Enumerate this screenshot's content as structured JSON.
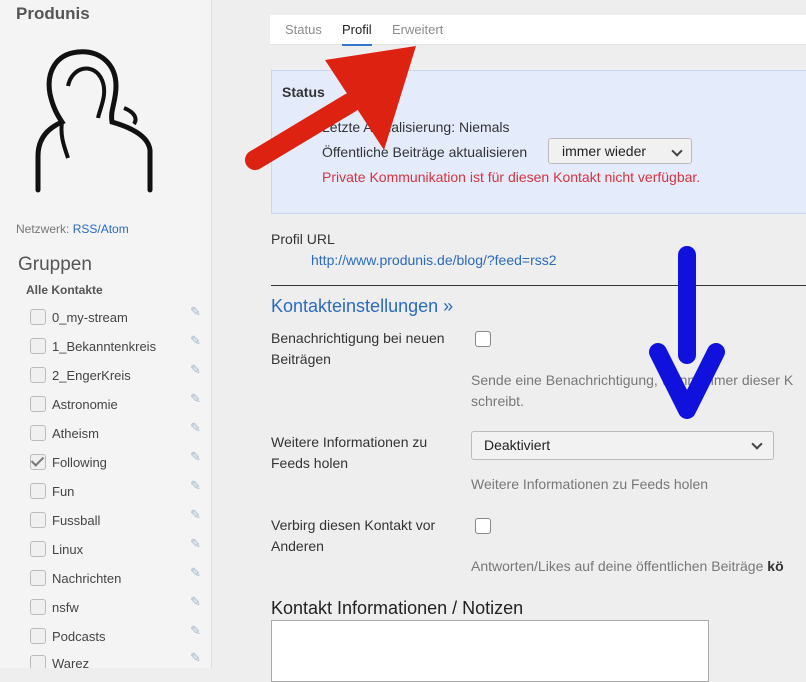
{
  "sidebar": {
    "contact_name": "Produnis",
    "network_label": "Netzwerk:",
    "network_value": "RSS/Atom",
    "groups_heading": "Gruppen",
    "all_contacts": "Alle Kontakte",
    "groups": [
      {
        "label": "0_my-stream",
        "checked": false
      },
      {
        "label": "1_Bekanntenkreis",
        "checked": false
      },
      {
        "label": "2_EngerKreis",
        "checked": false
      },
      {
        "label": "Astronomie",
        "checked": false
      },
      {
        "label": "Atheism",
        "checked": false
      },
      {
        "label": "Following",
        "checked": true
      },
      {
        "label": "Fun",
        "checked": false
      },
      {
        "label": "Fussball",
        "checked": false
      },
      {
        "label": "Linux",
        "checked": false
      },
      {
        "label": "Nachrichten",
        "checked": false
      },
      {
        "label": "nsfw",
        "checked": false
      },
      {
        "label": "Podcasts",
        "checked": false
      },
      {
        "label": "Warez",
        "checked": false
      }
    ]
  },
  "tabs": [
    {
      "label": "Status",
      "active": false
    },
    {
      "label": "Profil",
      "active": true
    },
    {
      "label": "Erweitert",
      "active": false
    }
  ],
  "status": {
    "title": "Status",
    "last_update": "Letzte Aktualisierung: Niemals",
    "public_posts_label": "Öffentliche Beiträge aktualisieren",
    "public_posts_value": "immer wieder",
    "private_note": "Private Kommunikation ist für diesen Kontakt nicht verfügbar."
  },
  "profile": {
    "url_label": "Profil URL",
    "url": "http://www.produnis.de/blog/?feed=rss2"
  },
  "settings": {
    "heading": "Kontakteinstellungen »",
    "notify_label": "Benachrichtigung bei neuen Beiträgen",
    "notify_help": "Sende eine Benachrichtigung, wann immer dieser K",
    "notify_help_2": "schreibt.",
    "feed_label": "Weitere Informationen zu Feeds holen",
    "feed_value": "Deaktiviert",
    "feed_help": "Weitere Informationen zu Feeds holen",
    "hide_label": "Verbirg diesen Kontakt vor Anderen",
    "hide_help": "Antworten/Likes auf deine öffentlichen Beiträge ",
    "hide_help_bold": "kö"
  },
  "notes": {
    "heading": "Kontakt Informationen / Notizen"
  },
  "colors": {
    "link": "#2a6bbf",
    "warning": "#d8323d",
    "annotation_red": "#dd2211",
    "annotation_blue": "#1111dd"
  }
}
